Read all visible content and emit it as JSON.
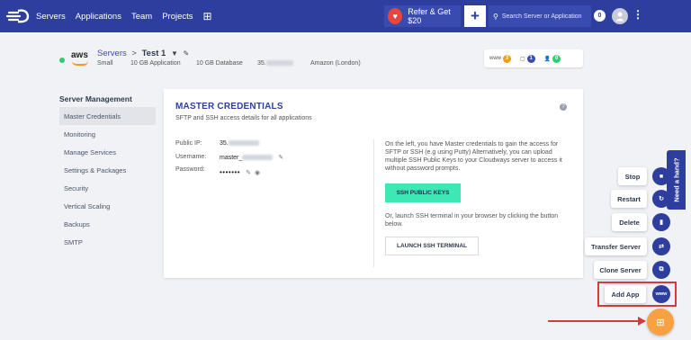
{
  "colors": {
    "nav": "#2e3e9e",
    "accent_green": "#3ee8b5",
    "fab_orange": "#f7a143",
    "annotation_red": "#d63a3a"
  },
  "nav": {
    "logo_icon": "cloudways-logo-icon",
    "links": [
      "Servers",
      "Applications",
      "Team",
      "Projects"
    ],
    "grid_icon": "apps-grid-icon",
    "refer_label": "Refer & Get $20",
    "plus_label": "+",
    "search_placeholder": "Search Server or Application",
    "count_badge": "0"
  },
  "server": {
    "provider": "aws",
    "breadcrumb_root": "Servers",
    "separator": ">",
    "name": "Test 1",
    "size": "Small",
    "app_storage": "10 GB Application",
    "db_storage": "10 GB Database",
    "ip": "35.",
    "location": "Amazon (London)",
    "stats": [
      {
        "label": "www",
        "count": "3",
        "color": "#f39c12"
      },
      {
        "label": "▢",
        "count": "1",
        "color": "#3a4bb0"
      },
      {
        "label": "👤",
        "count": "0",
        "color": "#2ecc71"
      }
    ]
  },
  "sidebar": {
    "heading": "Server Management",
    "items": [
      "Master Credentials",
      "Monitoring",
      "Manage Services",
      "Settings & Packages",
      "Security",
      "Vertical Scaling",
      "Backups",
      "SMTP"
    ]
  },
  "card": {
    "title": "MASTER CREDENTIALS",
    "subtitle": "SFTP and SSH access details for all applications",
    "public_ip_label": "Public IP:",
    "public_ip_value": "35.",
    "username_label": "Username:",
    "username_value": "master_",
    "password_label": "Password:",
    "password_value": "•••••••",
    "info_text": "On the left, you have Master credentials to gain the access for SFTP or SSH (e.g using Putty) Alternatively, you can upload multiple SSH Public Keys to your Cloudways server to access it without password prompts.",
    "ssh_keys_button": "SSH PUBLIC KEYS",
    "or_text": "Or, launch SSH terminal in your browser by clicking the button below.",
    "terminal_button": "LAUNCH SSH TERMINAL"
  },
  "quick_actions": {
    "need_hand": "Need a hand?",
    "stop": "Stop",
    "restart": "Restart",
    "delete": "Delete",
    "transfer": "Transfer Server",
    "clone": "Clone Server",
    "add_app": "Add App",
    "add_app_icon": "www"
  }
}
